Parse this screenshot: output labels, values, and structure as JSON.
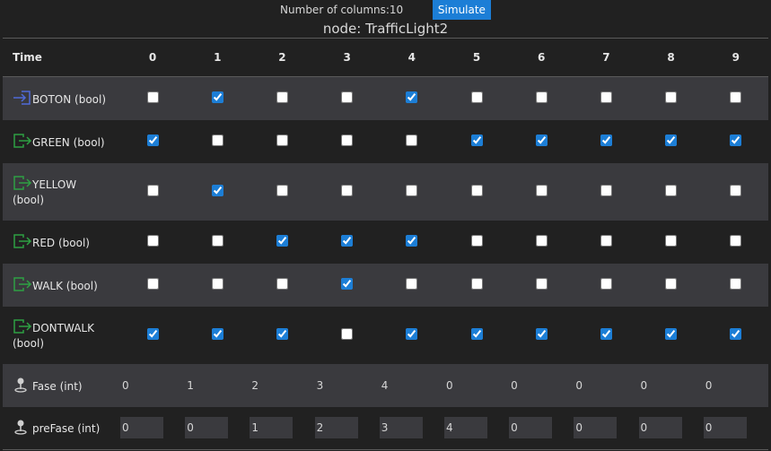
{
  "toolbar": {
    "columns_label": "Number of columns:",
    "columns_value": "10",
    "simulate_label": "Simulate"
  },
  "node_title": "node: TrafficLight2",
  "table": {
    "time_header": "Time",
    "columns": [
      "0",
      "1",
      "2",
      "3",
      "4",
      "5",
      "6",
      "7",
      "8",
      "9"
    ],
    "rows": [
      {
        "name": "BOTON (bool)",
        "kind": "input",
        "icon": "input-arrow-icon",
        "line1": "BOTON (bool)",
        "line2": "",
        "values": [
          false,
          true,
          false,
          false,
          true,
          false,
          false,
          false,
          false,
          false
        ]
      },
      {
        "name": "GREEN (bool)",
        "kind": "output",
        "icon": "output-arrow-icon",
        "line1": "GREEN (bool)",
        "line2": "",
        "values": [
          true,
          false,
          false,
          false,
          false,
          true,
          true,
          true,
          true,
          true
        ]
      },
      {
        "name": "YELLOW (bool)",
        "kind": "output",
        "icon": "output-arrow-icon",
        "line1": "YELLOW",
        "line2": "(bool)",
        "values": [
          false,
          true,
          false,
          false,
          false,
          false,
          false,
          false,
          false,
          false
        ]
      },
      {
        "name": "RED (bool)",
        "kind": "output",
        "icon": "output-arrow-icon",
        "line1": "RED (bool)",
        "line2": "",
        "values": [
          false,
          false,
          true,
          true,
          true,
          false,
          false,
          false,
          false,
          false
        ]
      },
      {
        "name": "WALK (bool)",
        "kind": "output",
        "icon": "output-arrow-icon",
        "line1": "WALK (bool)",
        "line2": "",
        "values": [
          false,
          false,
          false,
          true,
          false,
          false,
          false,
          false,
          false,
          false
        ]
      },
      {
        "name": "DONTWALK (bool)",
        "kind": "output",
        "icon": "output-arrow-icon",
        "line1": "DONTWALK",
        "line2": "(bool)",
        "values": [
          true,
          true,
          true,
          false,
          true,
          true,
          true,
          true,
          true,
          true
        ]
      },
      {
        "name": "Fase (int)",
        "kind": "int",
        "icon": "pin-icon",
        "line1": "Fase (int)",
        "line2": "",
        "values": [
          "0",
          "1",
          "2",
          "3",
          "4",
          "0",
          "0",
          "0",
          "0",
          "0"
        ]
      },
      {
        "name": "preFase (int)",
        "kind": "int",
        "icon": "pin-icon",
        "line1": "preFase (int)",
        "line2": "",
        "values": [
          "0",
          "0",
          "1",
          "2",
          "3",
          "4",
          "0",
          "0",
          "0",
          "0"
        ]
      }
    ]
  },
  "colors": {
    "input_icon": "#4f6bd8",
    "output_icon": "#2ea043",
    "pin_icon": "#cfcfcf",
    "accent": "#1c7ed6"
  }
}
